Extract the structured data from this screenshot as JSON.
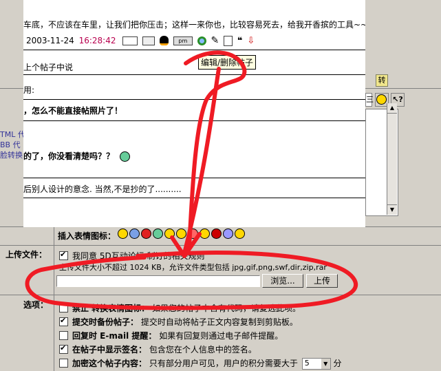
{
  "colors": {
    "time": "#b8004e",
    "annotation": "#ef1b24",
    "window_bg": "#ffffff",
    "form_bg": "#d4d0c8"
  },
  "post": {
    "text1": "车底，不应该在车里，让我们把你压击；这样一来你也，比较容易死去，给我开香摈的工具~~",
    "date": "2003-11-24",
    "time": "16:28:42",
    "line3": "上个帖子中说",
    "line4": "用:",
    "line5": "，怎么不能直接帖照片了！",
    "line6": "的了，你没看清楚吗？？",
    "line7": "后别人设计的意念. 当然,不是抄的了..........",
    "tooltip": "编辑/删除帖子",
    "pm_label": "pm"
  },
  "left_fragments": [
    "TML 代",
    "BB 代",
    "脸转换"
  ],
  "toolbar_right": {
    "zhuan": "转"
  },
  "form": {
    "emoticon_label": "插入表情图标：",
    "upload_label": "上传文件：",
    "upload_agree": "我同意 5D互动论坛 制订的相关规则",
    "upload_hint": "上传文件大小不超过 1024 KB，允许文件类型包括 jpg,gif,png,swf,dir,zip,rar",
    "browse_btn": "浏览...",
    "upload_btn": "上传",
    "options_label": "选项：",
    "opt1_title": "禁止 转换表情图标：",
    "opt1_desc": "如果您的帖子中含有代码，请复选此项。",
    "opt2_title": "提交时备份帖子：",
    "opt2_desc": "提交时自动将帖子正文内容复制到剪贴板。",
    "opt3_title": "回复时 E-mail 提醒：",
    "opt3_desc": "如果有回复则通过电子邮件提醒。",
    "opt4_title": "在帖子中显示签名：",
    "opt4_desc": "包含您在个人信息中的签名。",
    "opt5_title": "加密这个帖子内容：",
    "opt5_desc": "只有部分用户可见，用户的积分需要大于",
    "opt5_value": "5",
    "opt5_suffix": "分"
  }
}
